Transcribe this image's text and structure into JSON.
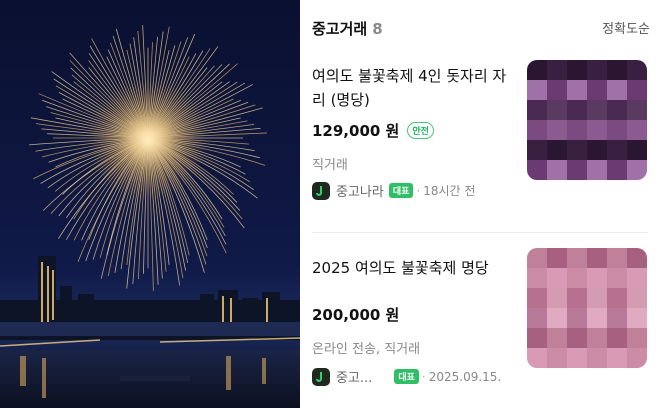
{
  "header": {
    "title": "중고거래",
    "count": "8",
    "sort_label": "정확도순"
  },
  "listings": [
    {
      "title": "여의도 불꽃축제 4인 돗자리 자리 (명당)",
      "price": "129,000 원",
      "safe_badge": "안전",
      "method": "직거래",
      "source": "중고나라",
      "rep_badge": "대표",
      "time": "18시간 전"
    },
    {
      "title": "2025 여의도 불꽃축제 명당",
      "price": "200,000 원",
      "method": "온라인 전송, 직거래",
      "source": "중고...",
      "rep_badge": "대표",
      "time": "2025.09.15."
    }
  ],
  "colors": {
    "accent_green": "#2fbf66",
    "safe_green": "#1bb05c",
    "night_sky": "#0b1230"
  }
}
